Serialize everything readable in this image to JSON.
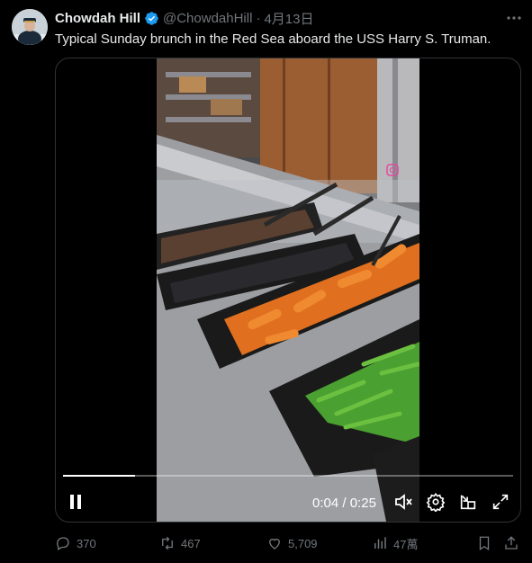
{
  "author": {
    "name": "Chowdah Hill",
    "handle": "@ChowdahHill",
    "separator": "·",
    "date": "4月13日",
    "verified": true
  },
  "tweet": {
    "text": "Typical Sunday brunch in the Red Sea aboard the USS Harry S. Truman."
  },
  "video": {
    "current_time": "0:04",
    "duration": "0:25",
    "time_separator": " / ",
    "progress": 0.16,
    "watermark_icon": "instagram-icon",
    "state": "playing",
    "muted": true
  },
  "actions": {
    "replies": "370",
    "reposts": "467",
    "likes": "5,709",
    "views": "47萬"
  },
  "colors": {
    "background": "#000000",
    "text": "#e7e9ea",
    "muted_text": "#71767b",
    "verified": "#1d9bf0",
    "border": "#2f3336"
  },
  "icons": {
    "more": "more-dots-icon",
    "verified": "verified-badge-icon",
    "pause": "pause-icon",
    "mute": "muted-speaker-icon",
    "settings": "gear-icon",
    "pip": "picture-in-picture-icon",
    "fullscreen": "fullscreen-icon",
    "reply": "reply-icon",
    "repost": "repost-icon",
    "like": "heart-icon",
    "views": "views-bar-icon",
    "bookmark": "bookmark-icon",
    "share": "share-icon"
  }
}
